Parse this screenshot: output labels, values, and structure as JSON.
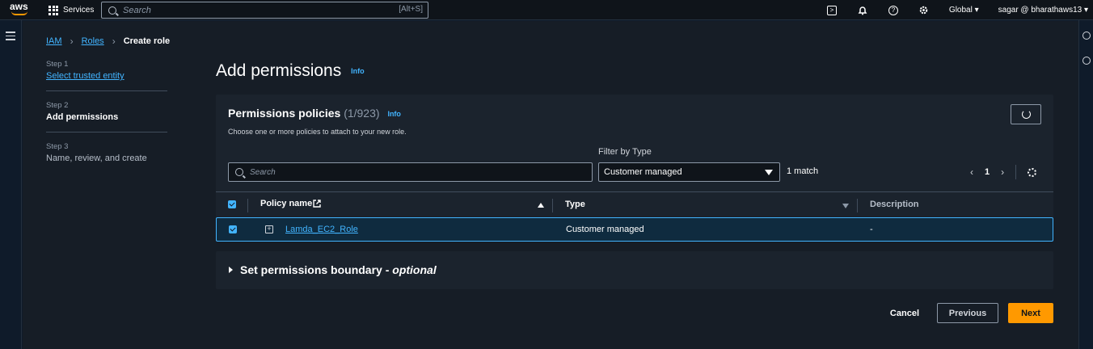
{
  "topnav": {
    "logo_text": "aws",
    "services_label": "Services",
    "search_placeholder": "Search",
    "search_shortcut": "[Alt+S]",
    "region": "Global",
    "user": "sagar @ bharathaws13",
    "icons": [
      "cloudshell-icon",
      "bell-icon",
      "help-icon",
      "gear-icon"
    ]
  },
  "breadcrumb": {
    "items": [
      "IAM",
      "Roles"
    ],
    "current": "Create role"
  },
  "steps": [
    {
      "num": "Step 1",
      "label": "Select trusted entity"
    },
    {
      "num": "Step 2",
      "label": "Add permissions"
    },
    {
      "num": "Step 3",
      "label": "Name, review, and create"
    }
  ],
  "page": {
    "title": "Add permissions",
    "info": "Info"
  },
  "policies": {
    "title": "Permissions policies",
    "count": "(1/923)",
    "info": "Info",
    "description": "Choose one or more policies to attach to your new role.",
    "search_placeholder": "Search",
    "filter_label": "Filter by Type",
    "filter_value": "Customer managed",
    "match_text": "1 match",
    "page_number": "1",
    "columns": [
      "Policy name",
      "Type",
      "Description"
    ],
    "rows": [
      {
        "name": "Lamda_EC2_Role",
        "type": "Customer managed",
        "description": "-",
        "selected": true
      }
    ]
  },
  "boundary": {
    "label": "Set permissions boundary",
    "optional": "optional"
  },
  "actions": {
    "cancel": "Cancel",
    "previous": "Previous",
    "next": "Next"
  },
  "colors": {
    "accent": "#42b4ff",
    "primary_button": "#ff9900"
  }
}
